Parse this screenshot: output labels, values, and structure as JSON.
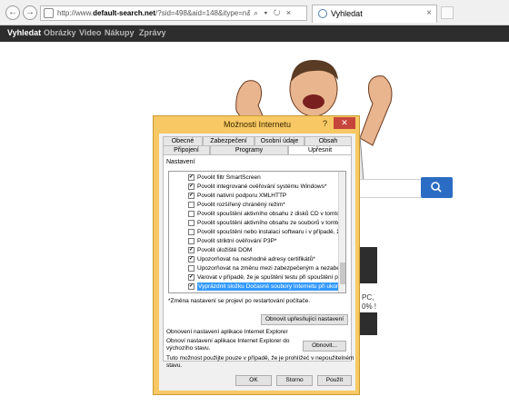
{
  "browser": {
    "back": "←",
    "forward": "→",
    "url_prefix": "http://www.",
    "url_host": "default-search.net",
    "url_rest": "/?sid=498&aid=148&itype=n&ver=13114&tm=424&src=",
    "address_tools": "⌕ ▾ ↻ ×",
    "tab_title": "Vyhledat",
    "tab_close": "×"
  },
  "site_nav": {
    "items": [
      "Vyhledat",
      "Obrázky",
      "Video",
      "Nákupy",
      "Zprávy"
    ]
  },
  "page": {
    "promo_text": "PC,\n0% !"
  },
  "dialog": {
    "title": "Možnosti Internetu",
    "help": "?",
    "close": "✕",
    "tabs_row1": [
      "Obecné",
      "Zabezpečení",
      "Osobní údaje",
      "Obsah"
    ],
    "tabs_row2": [
      "Připojení",
      "Programy",
      "Upřesnit"
    ],
    "active_tab": "Upřesnit",
    "settings_label": "Nastavení",
    "options": [
      {
        "label": "Povolit filtr SmartScreen",
        "checked": true
      },
      {
        "label": "Povolit integrované ověřování systému Windows*",
        "checked": true
      },
      {
        "label": "Povolit nativní podporu XMLHTTP",
        "checked": true
      },
      {
        "label": "Povolit rozšířený chráněný režim*",
        "checked": false
      },
      {
        "label": "Povolit spouštění aktivního obsahu z disků CD v tomto poč",
        "checked": false
      },
      {
        "label": "Povolit spouštění aktivního obsahu ze souborů v tomto poč",
        "checked": false
      },
      {
        "label": "Povolit spouštění nebo instalaci softwaru i v případě, že po",
        "checked": false
      },
      {
        "label": "Povolit striktní ověřování P3P*",
        "checked": false
      },
      {
        "label": "Povolit úložiště DOM",
        "checked": true
      },
      {
        "label": "Upozorňovat na neshodné adresy certifikátů*",
        "checked": true
      },
      {
        "label": "Upozorňovat na změnu mezi zabezpečeným a nezabezpeč",
        "checked": false
      },
      {
        "label": "Varovat v případě, že je spuštění testu při spouštění počíta",
        "checked": true
      },
      {
        "label": "Vyprázdnit složku Dočasné soubory Internetu při ukončení",
        "checked": true,
        "selected": true
      }
    ],
    "restart_note": "*Změna nastavení se projeví po restartování počítače.",
    "restore_button": "Obnovit upřesňující nastavení",
    "reset_group_label": "Obnovení nastavení aplikace Internet Explorer",
    "reset_desc": "Obnoví nastavení aplikace Internet Explorer do\nvýchozího stavu.",
    "reset_button": "Obnovit...",
    "reset_warning": "Tuto možnost použijte pouze v případě, že je prohlížeč v nepoužitelném\nstavu.",
    "ok": "OK",
    "cancel": "Storno",
    "apply": "Použít"
  },
  "colors": {
    "dialog_frame": "#f7c863",
    "close_button": "#c7463c",
    "selection": "#3399ff",
    "site_nav_bg": "#2d2d2d",
    "search_button": "#2b6cc4"
  }
}
